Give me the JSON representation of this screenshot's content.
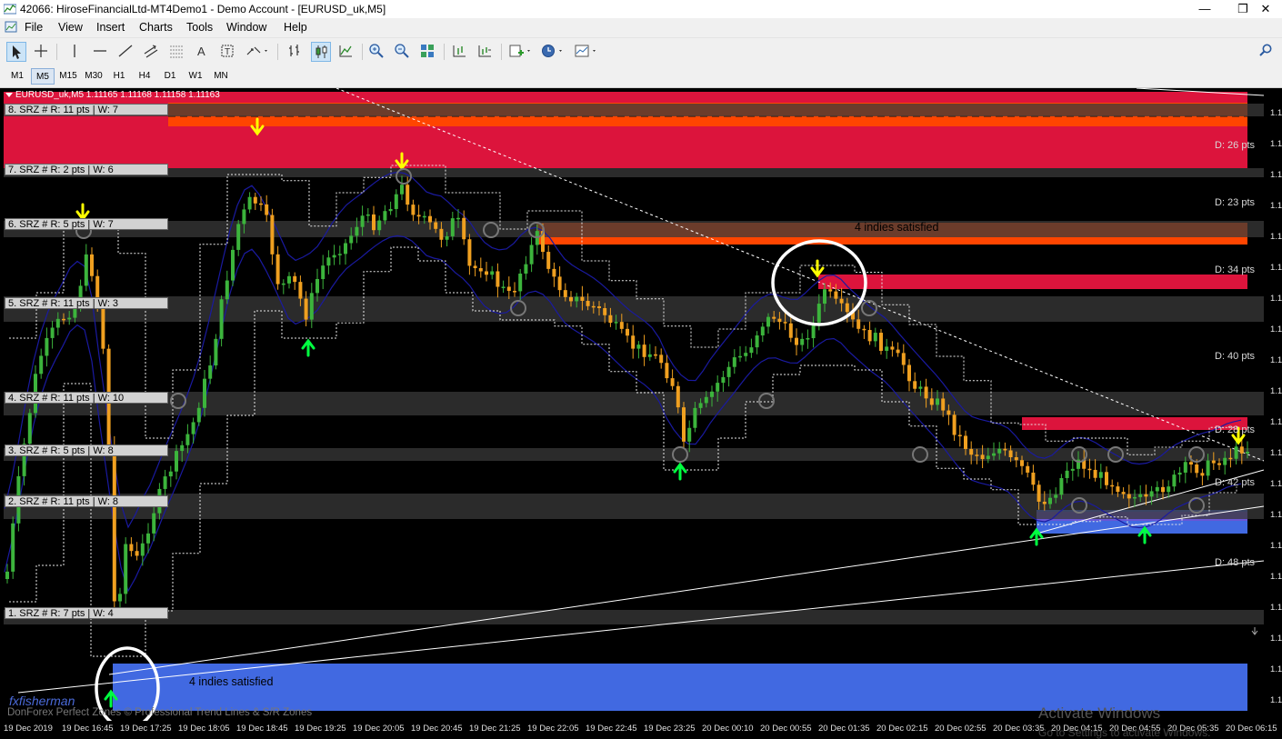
{
  "window": {
    "title": "42066: HiroseFinancialLtd-MT4Demo1 - Demo Account - [EURUSD_uk,M5]",
    "minimize": "—",
    "restore": "❐",
    "close": "✕"
  },
  "menu": {
    "items": [
      "File",
      "View",
      "Insert",
      "Charts",
      "Tools",
      "Window",
      "Help"
    ]
  },
  "timeframes": [
    "M1",
    "M5",
    "M15",
    "M30",
    "H1",
    "H4",
    "D1",
    "W1",
    "MN"
  ],
  "active_timeframe": "M5",
  "chart": {
    "header": "EURUSD_uk,M5  1.11165 1.11168 1.11158 1.11163",
    "srz_labels": [
      "8. SRZ # R: 11 pts | W: 7",
      "7. SRZ # R: 2 pts | W: 6",
      "6. SRZ # R: 5 pts | W: 7",
      "5. SRZ # R: 11 pts | W: 3",
      "4. SRZ # R: 11 pts | W: 10",
      "3. SRZ # R: 5 pts | W: 8",
      "2. SRZ # R: 11 pts | W: 8",
      "1. SRZ # R: 7 pts | W: 4"
    ],
    "distance_labels": [
      "D: 26 pts",
      "D: 23 pts",
      "D: 34 pts",
      "D: 40 pts",
      "D: 28 pts",
      "D: 42 pts",
      "D: 48 pts"
    ],
    "satisfied_labels": [
      "4 indies satisfied",
      "4 indies satisfied"
    ],
    "price_axis_ticks": [
      "1.1",
      "1.1",
      "1.1",
      "1.1",
      "1.1",
      "1.1",
      "1.1",
      "1.1",
      "1.1",
      "1.1",
      "1.1",
      "1.1",
      "1.1",
      "1.1",
      "1.1",
      "1.1",
      "1.1",
      "1.1",
      "1.1",
      "1.1"
    ],
    "time_labels": [
      "19 Dec 2019",
      "19 Dec 16:45",
      "19 Dec 17:25",
      "19 Dec 18:05",
      "19 Dec 18:45",
      "19 Dec 19:25",
      "19 Dec 20:05",
      "19 Dec 20:45",
      "19 Dec 21:25",
      "19 Dec 22:05",
      "19 Dec 22:45",
      "19 Dec 23:25",
      "20 Dec 00:10",
      "20 Dec 00:55",
      "20 Dec 01:35",
      "20 Dec 02:15",
      "20 Dec 02:55",
      "20 Dec 03:35",
      "20 Dec 04:15",
      "20 Dec 04:55",
      "20 Dec 05:35",
      "20 Dec 06:15"
    ],
    "watermark_left": "fxfisherman",
    "watermark_credit": "DonForex Perfect Zones © Professional Trend Lines & S/R Zones",
    "activate_title": "Activate Windows",
    "activate_sub": "Go to Settings to activate Windows.",
    "colors": {
      "background": "#000000",
      "bull_candle": "#3cb43c",
      "bear_candle": "#f0a020",
      "resistance_zone": "#dc143c",
      "resistance_zone_top": "#ff4500",
      "support_zone": "#4169e1",
      "srz_band": "#3a3a3a",
      "envelope": "#1a1aa0",
      "up_arrow": "#00ff40",
      "down_arrow": "#ffff00"
    }
  }
}
